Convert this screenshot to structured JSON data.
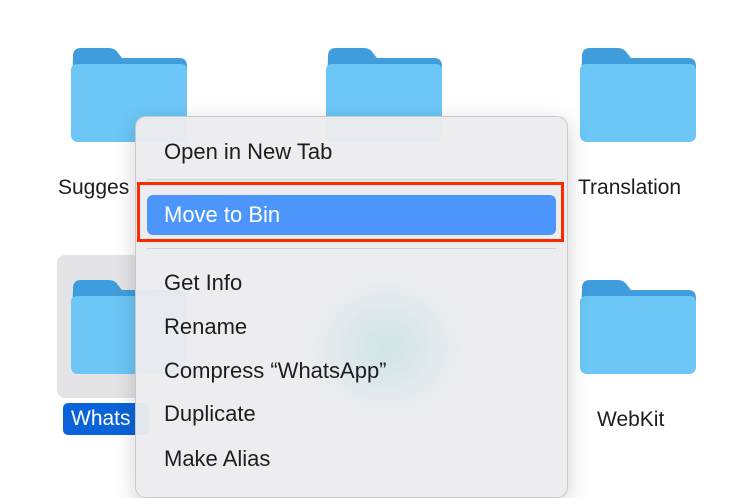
{
  "folders": [
    {
      "id": "suggestions",
      "label": "Sugges"
    },
    {
      "id": "middle",
      "label": ""
    },
    {
      "id": "translation",
      "label": "Translation"
    },
    {
      "id": "whatsapp",
      "label": "Whats",
      "selected": true
    },
    {
      "id": "webkit",
      "label": "WebKit"
    }
  ],
  "context_menu": {
    "items": [
      {
        "label": "Open in New Tab"
      },
      {
        "label": "Move to Bin",
        "highlighted": true
      },
      {
        "label": "Get Info"
      },
      {
        "label": "Rename"
      },
      {
        "label": "Compress “WhatsApp”"
      },
      {
        "label": "Duplicate"
      },
      {
        "label": "Make Alias"
      }
    ]
  },
  "colors": {
    "folder_light": "#6cc7f6",
    "folder_dark": "#3f9ddd",
    "highlight": "#4c95fa",
    "selection": "#0a63d9",
    "annotation": "#ff2a00"
  },
  "icons": {
    "folder": "folder-icon"
  }
}
